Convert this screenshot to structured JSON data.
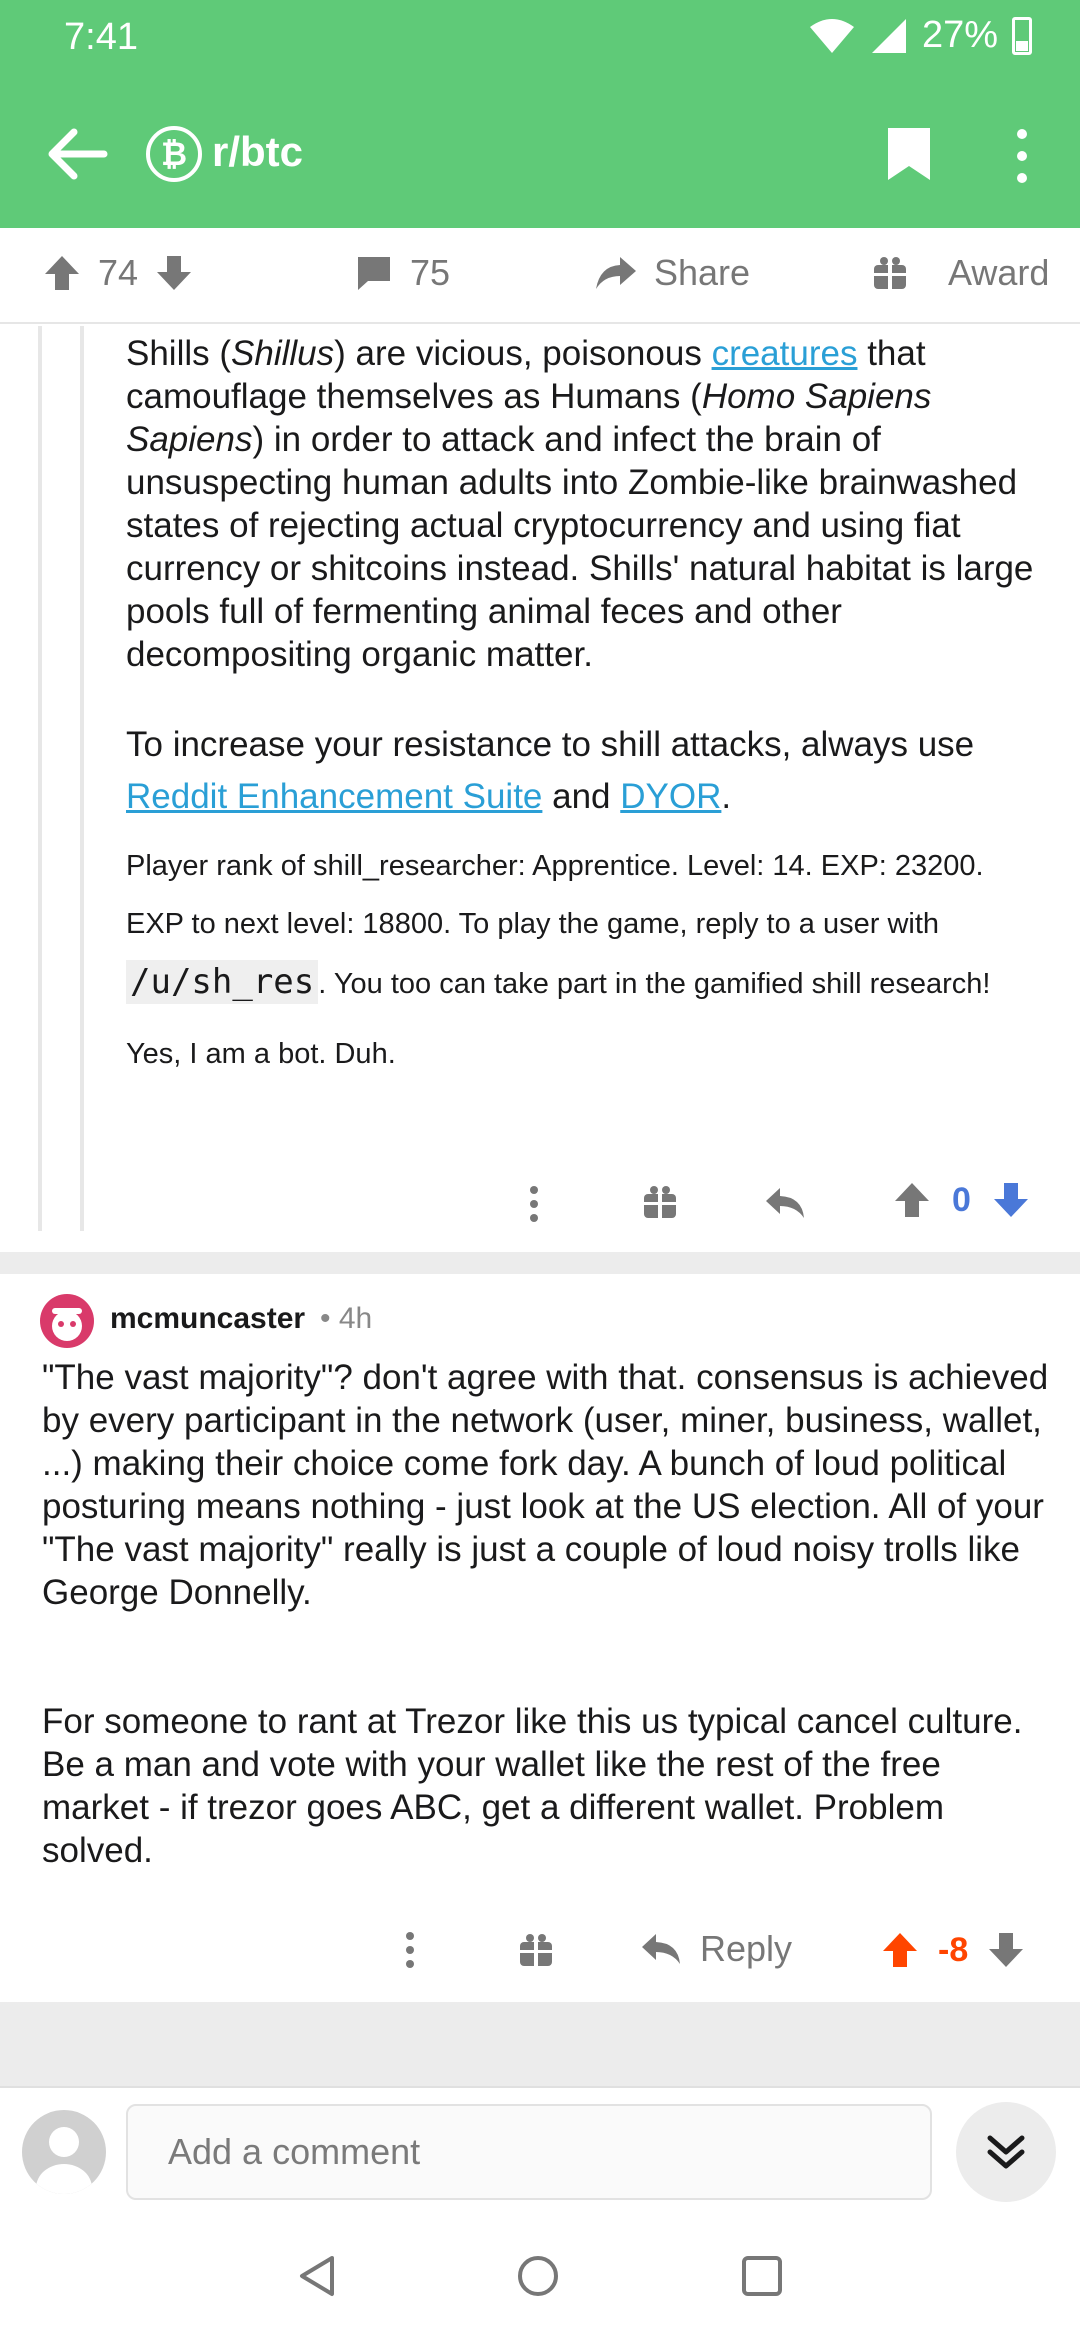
{
  "status": {
    "time": "7:41",
    "battery": "27%"
  },
  "header": {
    "subreddit": "r/btc",
    "sub_icon_glyph": "₿"
  },
  "post_actions": {
    "score": "74",
    "comments": "75",
    "share_label": "Share",
    "award_label": "Award"
  },
  "bot_comment": {
    "p1_a": "Shills (",
    "p1_italic1": "Shillus",
    "p1_b": ") are vicious, poisonous ",
    "p1_link": "creatures",
    "p1_c": " that camouflage themselves as Humans (",
    "p1_italic2": "Homo Sapiens Sapiens",
    "p1_d": ") in order to attack and infect the brain of unsuspecting human adults into Zombie-like brainwashed states of rejecting actual cryptocurrency and using fiat currency or shitcoins instead. Shills' natural habitat is large pools full of fermenting animal feces and other decompositing organic matter.",
    "p2_a": "To increase your resistance to shill attacks, always use ",
    "p2_link1": "Reddit Enhancement Suite",
    "p2_b": " and ",
    "p2_link2": "DYOR",
    "p2_c": ".",
    "p3_a": "Player rank of shill_researcher: Apprentice. Level: 14. EXP: 23200. EXP to next level: 18800. To play the game, reply to a user with ",
    "p3_code": "/u/sh_res",
    "p3_b": ". You too can take part in the gamified shill research!",
    "p4": "Yes, I am a bot. Duh.",
    "score": "0"
  },
  "comment2": {
    "author": "mcmuncaster",
    "time": "• 4h",
    "p1": "\"The vast majority\"? don't agree with that. consensus is achieved by every participant in the network (user, miner, business, wallet, ...) making their choice come fork day. A bunch of loud political posturing means nothing - just look at the US election. All of your \"The vast majority\" really is just a couple of loud noisy trolls like George Donnelly.",
    "p2": "For someone to rant at Trezor like this us typical cancel culture. Be a man and vote with your wallet like the rest of the free market - if trezor goes ABC, get a different wallet. Problem solved.",
    "reply_label": "Reply",
    "score": "-8"
  },
  "composer": {
    "placeholder": "Add a comment"
  },
  "colors": {
    "header_green": "#5fca78",
    "link_blue": "#2a9fd6",
    "upvote_orange": "#ff4500",
    "downvote_blue": "#4a78d8"
  }
}
